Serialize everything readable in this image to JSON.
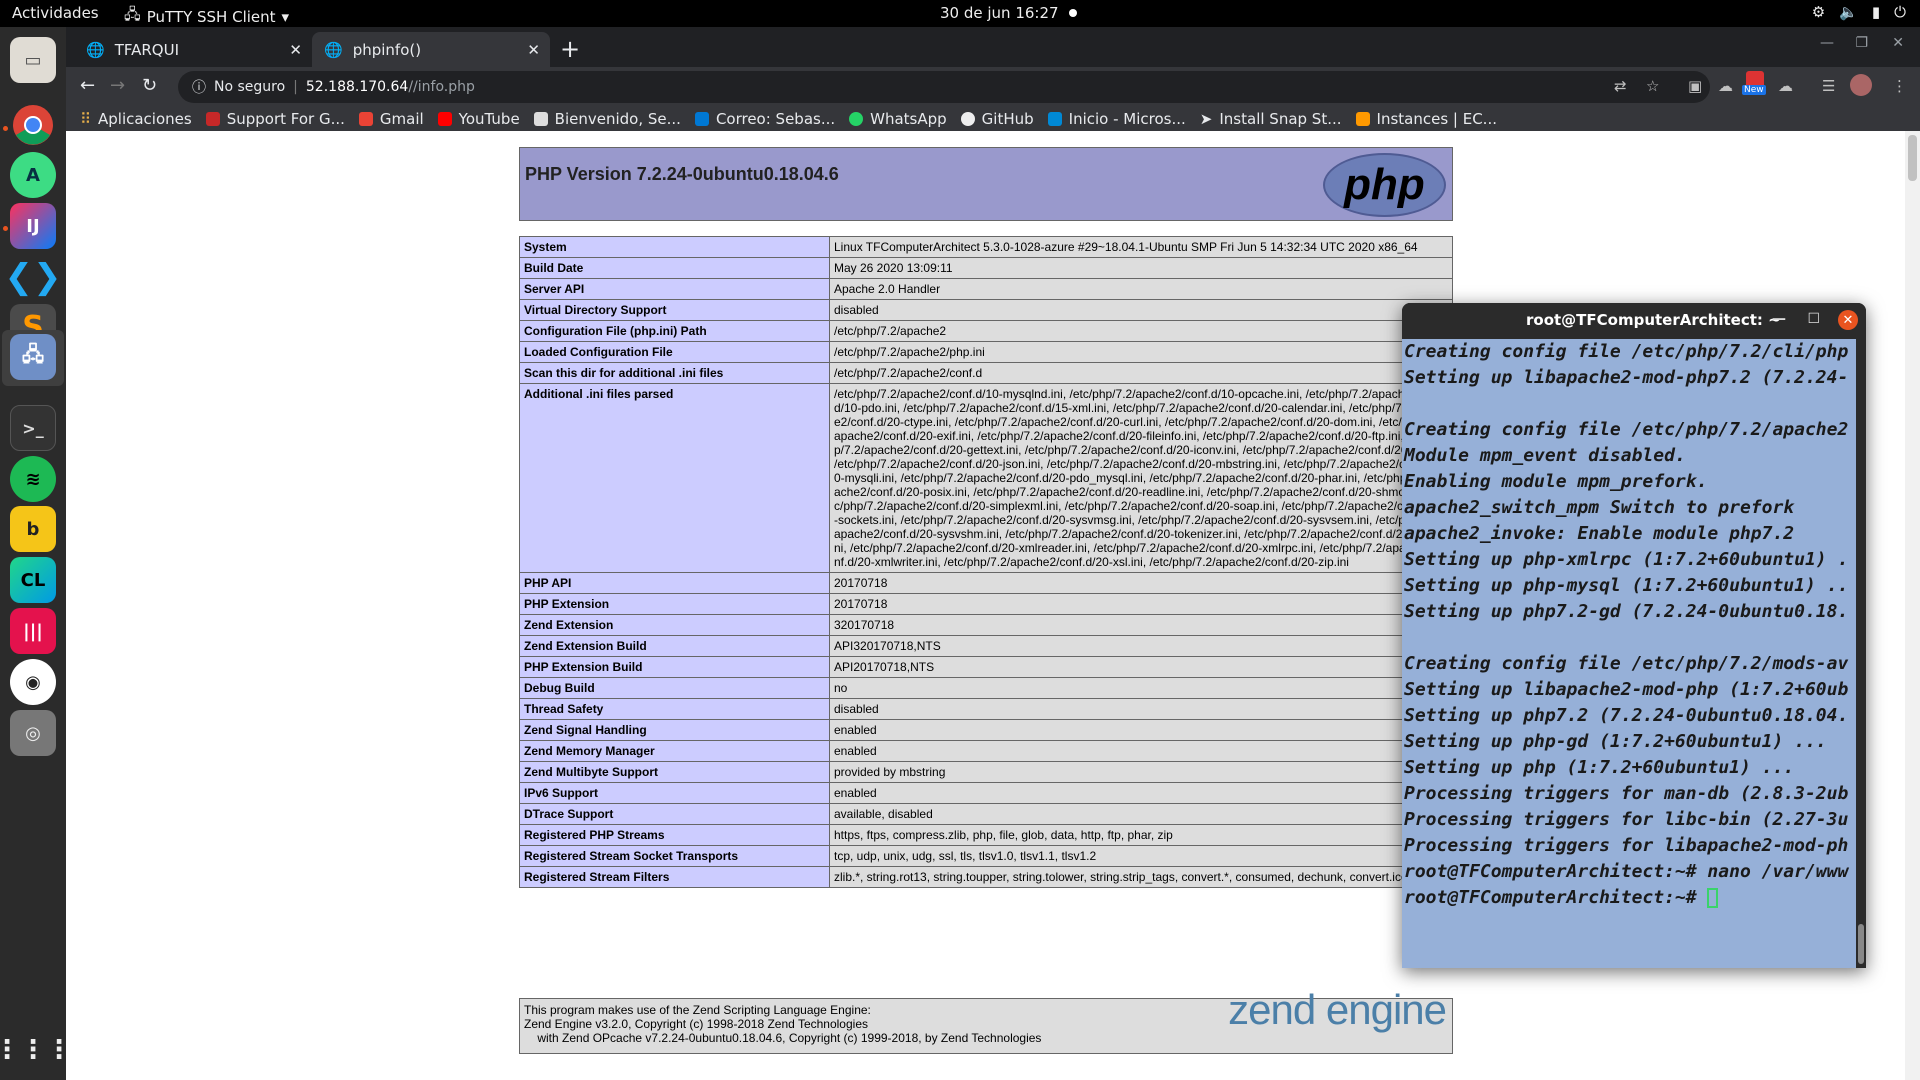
{
  "topbar": {
    "activities": "Actividades",
    "app_menu": "PuTTY SSH Client",
    "clock": "30 de jun  16:27",
    "tray_icons": [
      "network-icon",
      "volume-icon",
      "battery-icon",
      "power-icon"
    ]
  },
  "dock": {
    "apps": [
      "files",
      "chrome",
      "android-studio",
      "intellij",
      "vscode",
      "sublime-text",
      "putty",
      "terminal",
      "spotify",
      "bitwarden",
      "clion",
      "deezer",
      "obs-studio",
      "disk",
      "show-apps"
    ]
  },
  "browser": {
    "tabs": [
      {
        "label": "TFARQUI",
        "active": false
      },
      {
        "label": "phpinfo()",
        "active": true
      }
    ],
    "security_label": "No seguro",
    "url_host": "52.188.170.64",
    "url_path": "//info.php",
    "bookmarks": [
      "Aplicaciones",
      "Support For G...",
      "Gmail",
      "YouTube",
      "Bienvenido, Se...",
      "Correo: Sebas...",
      "WhatsApp",
      "GitHub",
      "Inicio - Micros...",
      "Install Snap St...",
      "Instances | EC..."
    ],
    "new_badge": "New"
  },
  "phpinfo": {
    "title": "PHP Version 7.2.24-0ubuntu0.18.04.6",
    "logo_text": "php",
    "rows": [
      {
        "key": "System",
        "value": "Linux TFComputerArchitect 5.3.0-1028-azure #29~18.04.1-Ubuntu SMP Fri Jun 5 14:32:34 UTC 2020 x86_64"
      },
      {
        "key": "Build Date",
        "value": "May 26 2020 13:09:11"
      },
      {
        "key": "Server API",
        "value": "Apache 2.0 Handler"
      },
      {
        "key": "Virtual Directory Support",
        "value": "disabled"
      },
      {
        "key": "Configuration File (php.ini) Path",
        "value": "/etc/php/7.2/apache2"
      },
      {
        "key": "Loaded Configuration File",
        "value": "/etc/php/7.2/apache2/php.ini"
      },
      {
        "key": "Scan this dir for additional .ini files",
        "value": "/etc/php/7.2/apache2/conf.d"
      },
      {
        "key": "Additional .ini files parsed",
        "value": "/etc/php/7.2/apache2/conf.d/10-mysqlnd.ini, /etc/php/7.2/apache2/conf.d/10-opcache.ini, /etc/php/7.2/apache2/conf.d/10-pdo.ini, /etc/php/7.2/apache2/conf.d/15-xml.ini, /etc/php/7.2/apache2/conf.d/20-calendar.ini, /etc/php/7.2/apache2/conf.d/20-ctype.ini, /etc/php/7.2/apache2/conf.d/20-curl.ini, /etc/php/7.2/apache2/conf.d/20-dom.ini, /etc/php/7.2/apache2/conf.d/20-exif.ini, /etc/php/7.2/apache2/conf.d/20-fileinfo.ini, /etc/php/7.2/apache2/conf.d/20-ftp.ini, /etc/php/7.2/apache2/conf.d/20-gettext.ini, /etc/php/7.2/apache2/conf.d/20-iconv.ini, /etc/php/7.2/apache2/conf.d/20-intl.ini, /etc/php/7.2/apache2/conf.d/20-json.ini, /etc/php/7.2/apache2/conf.d/20-mbstring.ini, /etc/php/7.2/apache2/conf.d/20-mysqli.ini, /etc/php/7.2/apache2/conf.d/20-pdo_mysql.ini, /etc/php/7.2/apache2/conf.d/20-phar.ini, /etc/php/7.2/apache2/conf.d/20-posix.ini, /etc/php/7.2/apache2/conf.d/20-readline.ini, /etc/php/7.2/apache2/conf.d/20-shmop.ini, /etc/php/7.2/apache2/conf.d/20-simplexml.ini, /etc/php/7.2/apache2/conf.d/20-soap.ini, /etc/php/7.2/apache2/conf.d/20-sockets.ini, /etc/php/7.2/apache2/conf.d/20-sysvmsg.ini, /etc/php/7.2/apache2/conf.d/20-sysvsem.ini, /etc/php/7.2/apache2/conf.d/20-sysvshm.ini, /etc/php/7.2/apache2/conf.d/20-tokenizer.ini, /etc/php/7.2/apache2/conf.d/20-wddx.ini, /etc/php/7.2/apache2/conf.d/20-xmlreader.ini, /etc/php/7.2/apache2/conf.d/20-xmlrpc.ini, /etc/php/7.2/apache2/conf.d/20-xmlwriter.ini, /etc/php/7.2/apache2/conf.d/20-xsl.ini, /etc/php/7.2/apache2/conf.d/20-zip.ini"
      },
      {
        "key": "PHP API",
        "value": "20170718"
      },
      {
        "key": "PHP Extension",
        "value": "20170718"
      },
      {
        "key": "Zend Extension",
        "value": "320170718"
      },
      {
        "key": "Zend Extension Build",
        "value": "API320170718,NTS"
      },
      {
        "key": "PHP Extension Build",
        "value": "API20170718,NTS"
      },
      {
        "key": "Debug Build",
        "value": "no"
      },
      {
        "key": "Thread Safety",
        "value": "disabled"
      },
      {
        "key": "Zend Signal Handling",
        "value": "enabled"
      },
      {
        "key": "Zend Memory Manager",
        "value": "enabled"
      },
      {
        "key": "Zend Multibyte Support",
        "value": "provided by mbstring"
      },
      {
        "key": "IPv6 Support",
        "value": "enabled"
      },
      {
        "key": "DTrace Support",
        "value": "available, disabled"
      },
      {
        "key": "Registered PHP Streams",
        "value": "https, ftps, compress.zlib, php, file, glob, data, http, ftp, phar, zip"
      },
      {
        "key": "Registered Stream Socket Transports",
        "value": "tcp, udp, unix, udg, ssl, tls, tlsv1.0, tlsv1.1, tlsv1.2"
      },
      {
        "key": "Registered Stream Filters",
        "value": "zlib.*, string.rot13, string.toupper, string.tolower, string.strip_tags, convert.*, consumed, dechunk, convert.iconv.*"
      }
    ],
    "zend_lines": [
      "This program makes use of the Zend Scripting Language Engine:",
      "Zend Engine v3.2.0, Copyright (c) 1998-2018 Zend Technologies",
      "    with Zend OPcache v7.2.24-0ubuntu0.18.04.6, Copyright (c) 1999-2018, by Zend Technologies"
    ],
    "zend_logo": "zend engine"
  },
  "terminal": {
    "title": "root@TFComputerArchitect: ~",
    "lines": [
      "Creating config file /etc/php/7.2/cli/php",
      "Setting up libapache2-mod-php7.2 (7.2.24-",
      "",
      "Creating config file /etc/php/7.2/apache2",
      "Module mpm_event disabled.",
      "Enabling module mpm_prefork.",
      "apache2_switch_mpm Switch to prefork",
      "apache2_invoke: Enable module php7.2",
      "Setting up php-xmlrpc (1:7.2+60ubuntu1) .",
      "Setting up php-mysql (1:7.2+60ubuntu1) ..",
      "Setting up php7.2-gd (7.2.24-0ubuntu0.18.",
      "",
      "Creating config file /etc/php/7.2/mods-av",
      "Setting up libapache2-mod-php (1:7.2+60ub",
      "Setting up php7.2 (7.2.24-0ubuntu0.18.04.",
      "Setting up php-gd (1:7.2+60ubuntu1) ...",
      "Setting up php (1:7.2+60ubuntu1) ...",
      "Processing triggers for man-db (2.8.3-2ub",
      "Processing triggers for libc-bin (2.27-3u",
      "Processing triggers for libapache2-mod-ph",
      "root@TFComputerArchitect:~# nano /var/www"
    ],
    "prompt": "root@TFComputerArchitect:~# "
  }
}
